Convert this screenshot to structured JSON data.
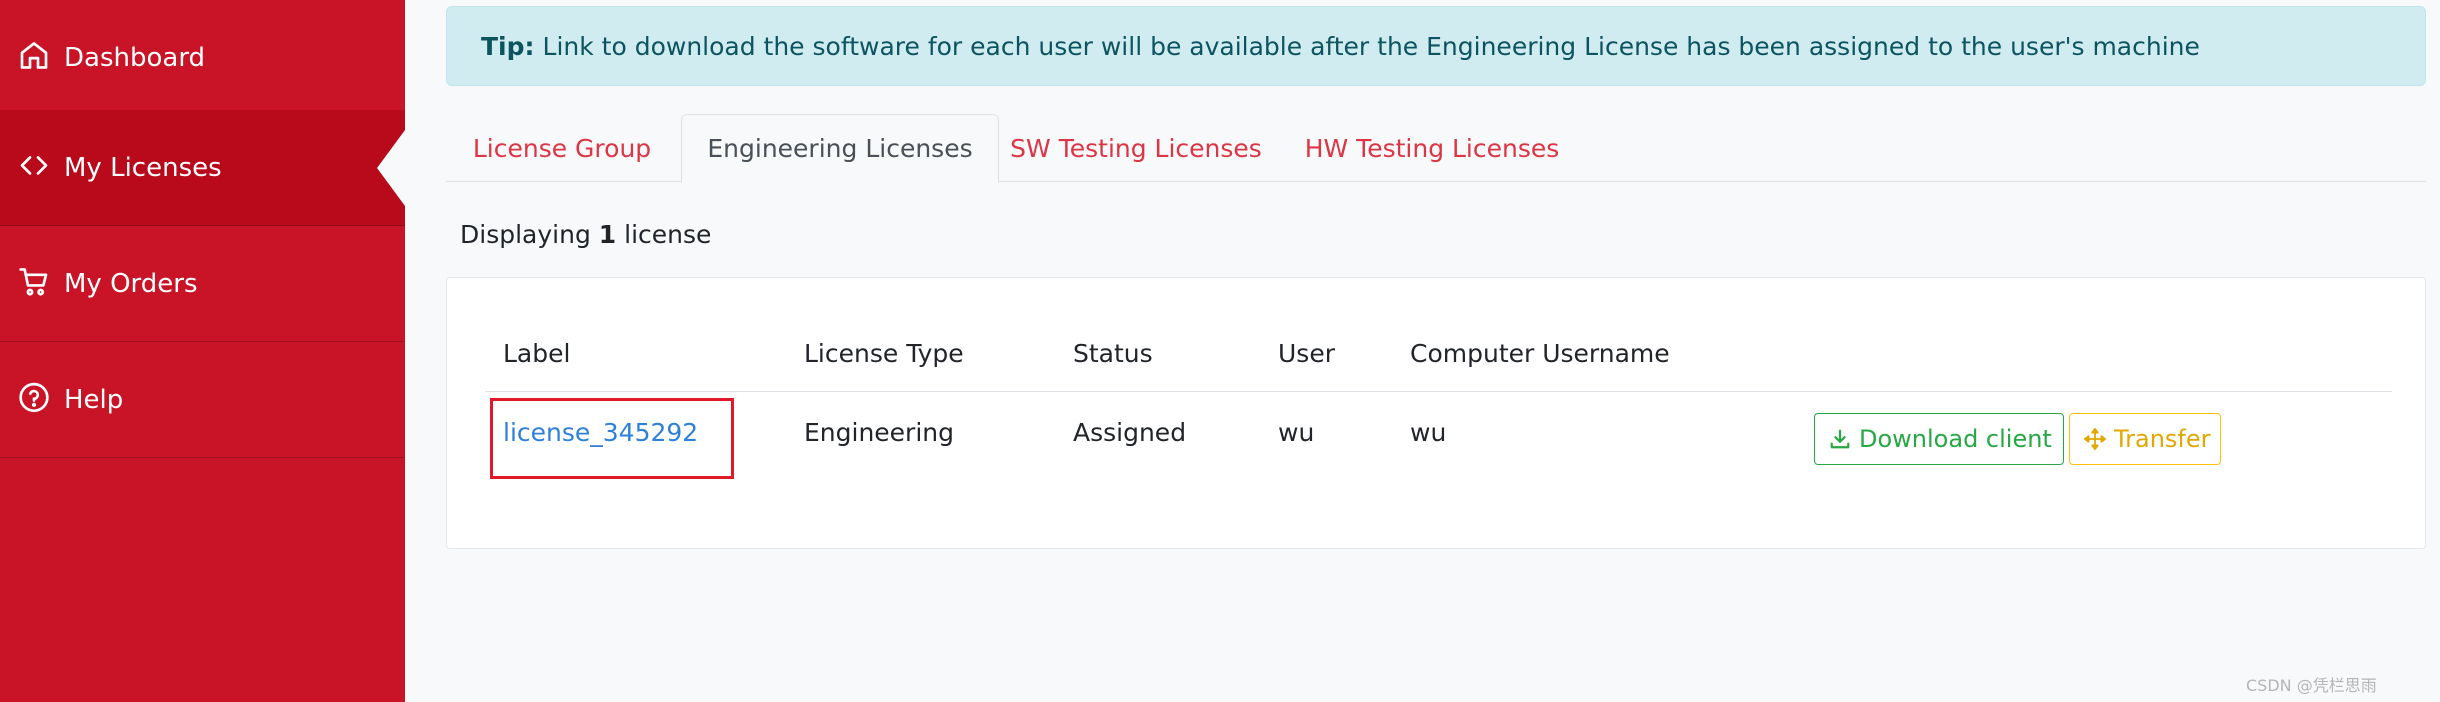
{
  "sidebar": {
    "items": [
      {
        "label": "Dashboard",
        "icon": "home-icon"
      },
      {
        "label": "My Licenses",
        "icon": "code-icon",
        "active": true
      },
      {
        "label": "My Orders",
        "icon": "cart-icon"
      },
      {
        "label": "Help",
        "icon": "question-circle-icon"
      }
    ]
  },
  "tip": {
    "strong": "Tip:",
    "text": "Link to download the software for each user will be available after the Engineering License has been assigned to the user's machine"
  },
  "tabs": [
    {
      "label": "License Group"
    },
    {
      "label": "Engineering Licenses",
      "active": true
    },
    {
      "label": "SW Testing Licenses"
    },
    {
      "label": "HW Testing Licenses"
    }
  ],
  "displaying": {
    "prefix": "Displaying",
    "count": "1",
    "suffix": "license"
  },
  "table": {
    "headers": [
      "Label",
      "License Type",
      "Status",
      "User",
      "Computer Username"
    ],
    "rows": [
      {
        "label": "license_345292",
        "license_type": "Engineering",
        "status": "Assigned",
        "user": "wu",
        "computer_username": "wu"
      }
    ],
    "actions": {
      "download": "Download client",
      "transfer": "Transfer"
    }
  },
  "watermark": "CSDN @凭栏思雨",
  "colors": {
    "sidebar": "#c81426",
    "sidebar_active": "#b80a1b",
    "tab_link": "#dc3545",
    "link": "#2f80d9",
    "success": "#28a745",
    "warning": "#ffc107",
    "info_bg": "#d1ecf1",
    "highlight_box": "#e0192b"
  }
}
